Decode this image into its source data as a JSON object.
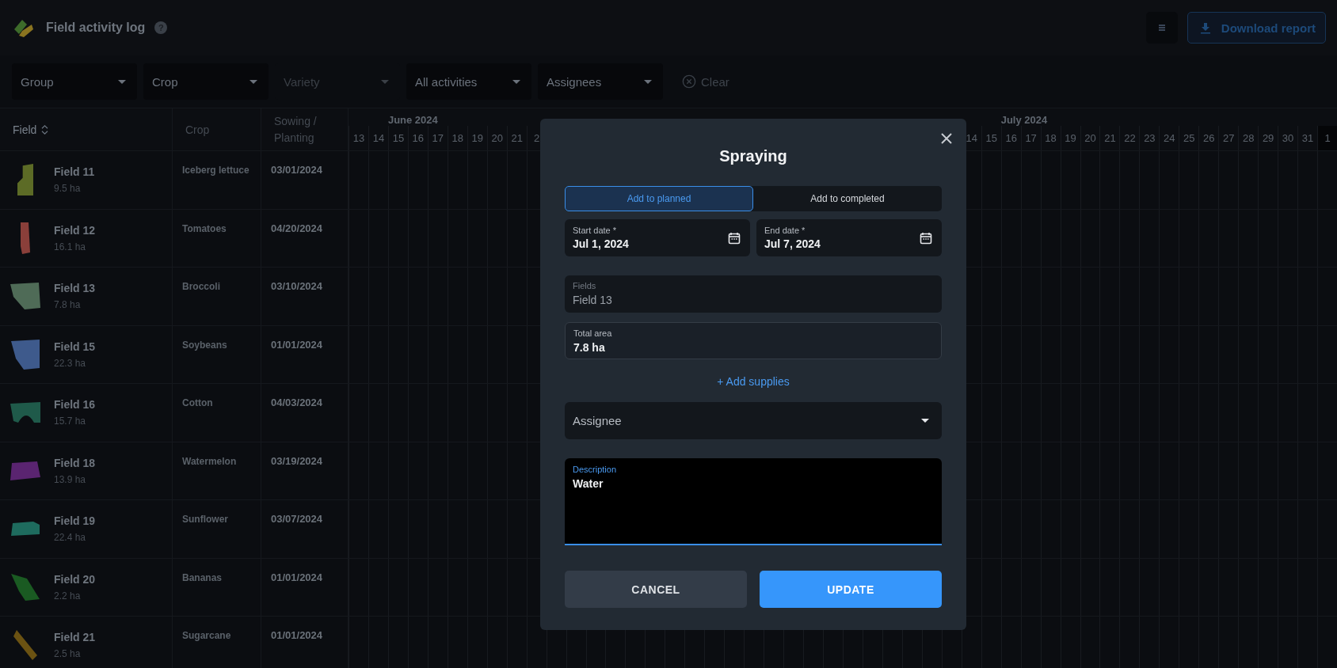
{
  "header": {
    "title": "Field activity log",
    "help": "?",
    "download_label": "Download report"
  },
  "filters": [
    {
      "label": "Group",
      "disabled": false
    },
    {
      "label": "Crop",
      "disabled": false
    },
    {
      "label": "Variety",
      "disabled": true
    },
    {
      "label": "All activities",
      "disabled": false
    },
    {
      "label": "Assignees",
      "disabled": false
    }
  ],
  "clear_label": "Clear",
  "table": {
    "columns": [
      "Field",
      "Crop",
      "Sowing / Planting"
    ],
    "rows": [
      {
        "name": "Field 11",
        "area": "9.5 ha",
        "crop": "Iceberg lettuce",
        "sowing": "03/01/2024",
        "color": "#5c6b26"
      },
      {
        "name": "Field 12",
        "area": "16.1 ha",
        "crop": "Tomatoes",
        "sowing": "04/20/2024",
        "color": "#8a3f3a"
      },
      {
        "name": "Field 13",
        "area": "7.8 ha",
        "crop": "Broccoli",
        "sowing": "03/10/2024",
        "color": "#4f6b57"
      },
      {
        "name": "Field 15",
        "area": "22.3 ha",
        "crop": "Soybeans",
        "sowing": "01/01/2024",
        "color": "#3e5a8c"
      },
      {
        "name": "Field 16",
        "area": "15.7 ha",
        "crop": "Cotton",
        "sowing": "04/03/2024",
        "color": "#1f5a4a"
      },
      {
        "name": "Field 18",
        "area": "13.9 ha",
        "crop": "Watermelon",
        "sowing": "03/19/2024",
        "color": "#5a2470"
      },
      {
        "name": "Field 19",
        "area": "22.4 ha",
        "crop": "Sunflower",
        "sowing": "03/07/2024",
        "color": "#1e6b5e"
      },
      {
        "name": "Field 20",
        "area": "2.2 ha",
        "crop": "Bananas",
        "sowing": "01/01/2024",
        "color": "#1a5a22"
      },
      {
        "name": "Field 21",
        "area": "2.5 ha",
        "crop": "Sugarcane",
        "sowing": "01/01/2024",
        "color": "#6b5212"
      }
    ]
  },
  "timeline": {
    "month_before": "June 2024",
    "month_after": "July 2024",
    "days_before": [
      "13",
      "14",
      "15",
      "16",
      "17",
      "18",
      "19",
      "20",
      "21",
      "2"
    ],
    "days_after": [
      "14",
      "15",
      "16",
      "17",
      "18",
      "19",
      "20",
      "21",
      "22",
      "23",
      "24",
      "25",
      "26",
      "27",
      "28",
      "29",
      "30",
      "31",
      "1"
    ]
  },
  "dialog": {
    "title": "Spraying",
    "modes": [
      {
        "label": "Add to planned",
        "selected": true
      },
      {
        "label": "Add to completed",
        "selected": false
      }
    ],
    "start_date": {
      "label": "Start date *",
      "value": "Jul 1, 2024"
    },
    "end_date": {
      "label": "End date *",
      "value": "Jul 7, 2024"
    },
    "fields": {
      "label": "Fields",
      "value": "Field 13",
      "disabled": true
    },
    "total_area": {
      "label": "Total area",
      "value": "7.8 ha"
    },
    "add_supplies": "+ Add supplies",
    "assignee": {
      "placeholder": "Assignee"
    },
    "description": {
      "label": "Description",
      "value": "Water",
      "focused": true
    },
    "buttons": [
      {
        "label": "CANCEL",
        "kind": "secondary"
      },
      {
        "label": "UPDATE",
        "kind": "primary"
      }
    ]
  }
}
